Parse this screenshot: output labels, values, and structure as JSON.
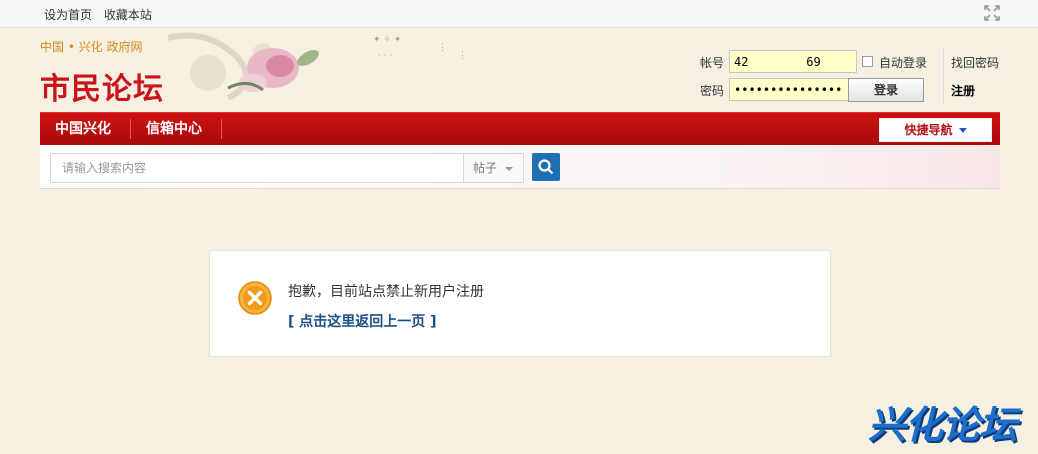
{
  "topbar": {
    "set_home": "设为首页",
    "bookmark": "收藏本站",
    "expand_icon": "fullscreen-icon"
  },
  "header": {
    "gov_link": "中国 • 兴化  政府网",
    "logo": "市民论坛"
  },
  "login": {
    "username_label": "帐号",
    "username_value": "42        69",
    "password_label": "密码",
    "password_value": "•••••••••••••••",
    "auto_login": "自动登录",
    "login_button": "登录",
    "forgot_password": "找回密码",
    "register": "注册"
  },
  "nav": {
    "items": [
      "中国兴化",
      "信箱中心"
    ],
    "quick_nav": "快捷导航"
  },
  "search": {
    "placeholder": "请输入搜索内容",
    "type": "帖子"
  },
  "message": {
    "text": "抱歉，目前站点禁止新用户注册",
    "back_link": "[ 点击这里返回上一页 ]"
  },
  "footer_logo": "兴化论坛",
  "colors": {
    "nav_red": "#b80d0d",
    "link_blue": "#1a4e86",
    "search_button": "#1f6fb4",
    "error_orange": "#f39a1e"
  }
}
